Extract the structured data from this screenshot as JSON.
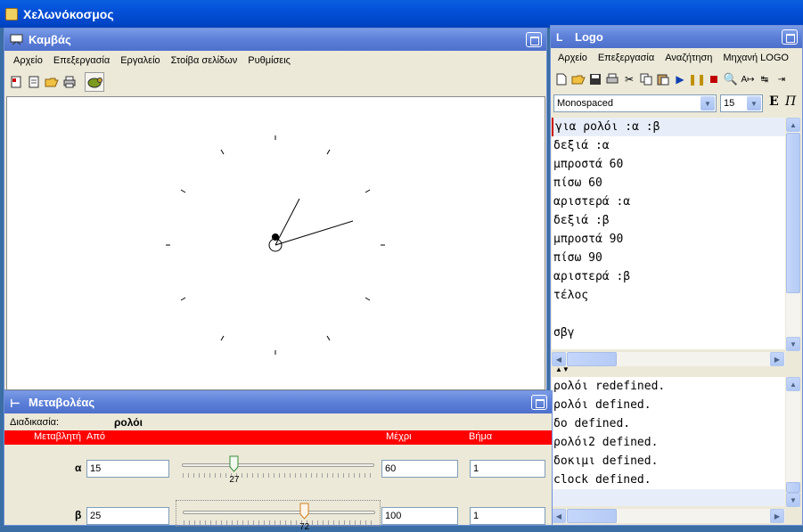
{
  "app": {
    "title": "Χελωνόκοσμος"
  },
  "canvas": {
    "title": "Καμβάς",
    "menu": [
      "Αρχείο",
      "Επεξεργασία",
      "Εργαλείο",
      "Στοίβα σελίδων",
      "Ρυθμίσεις"
    ]
  },
  "logo": {
    "title": "Logo",
    "menu": [
      "Αρχείο",
      "Επεξεργασία",
      "Αναζήτηση",
      "Μηχανή LOGO"
    ],
    "font_select": "Monospaced",
    "size_select": "15",
    "bold_label": "E",
    "italic_label": "Π",
    "code": [
      "για ρολόι :α :β",
      "δεξιά :α",
      "μπροστά 60",
      "πίσω 60",
      "αριστερά :α",
      "δεξιά :β",
      "μπροστά 90",
      "πίσω 90",
      "αριστερά :β",
      "τέλος",
      "",
      "σβγ"
    ],
    "output": [
      "ρολόι redefined.",
      "ρολόι defined.",
      "δο defined.",
      "ρολόι2 defined.",
      "δοκιμι defined.",
      "clock defined."
    ]
  },
  "variables": {
    "title": "Μεταβολέας",
    "procedure_label": "Διαδικασία:",
    "procedure_name": "ρολόι",
    "headers": {
      "variable": "Μεταβλητή",
      "from": "Από",
      "to": "Μέχρι",
      "step": "Βήμα"
    },
    "rows": [
      {
        "name": "α",
        "from": "15",
        "to": "60",
        "step": "1",
        "value": "27",
        "fraction": 0.27
      },
      {
        "name": "β",
        "from": "25",
        "to": "100",
        "step": "1",
        "value": "72",
        "fraction": 0.63
      }
    ]
  },
  "colors": {
    "title_blue": "#0350d8",
    "frame_title": "#5c7fd8",
    "header_red": "#ff0000",
    "panel": "#ece9d8"
  }
}
